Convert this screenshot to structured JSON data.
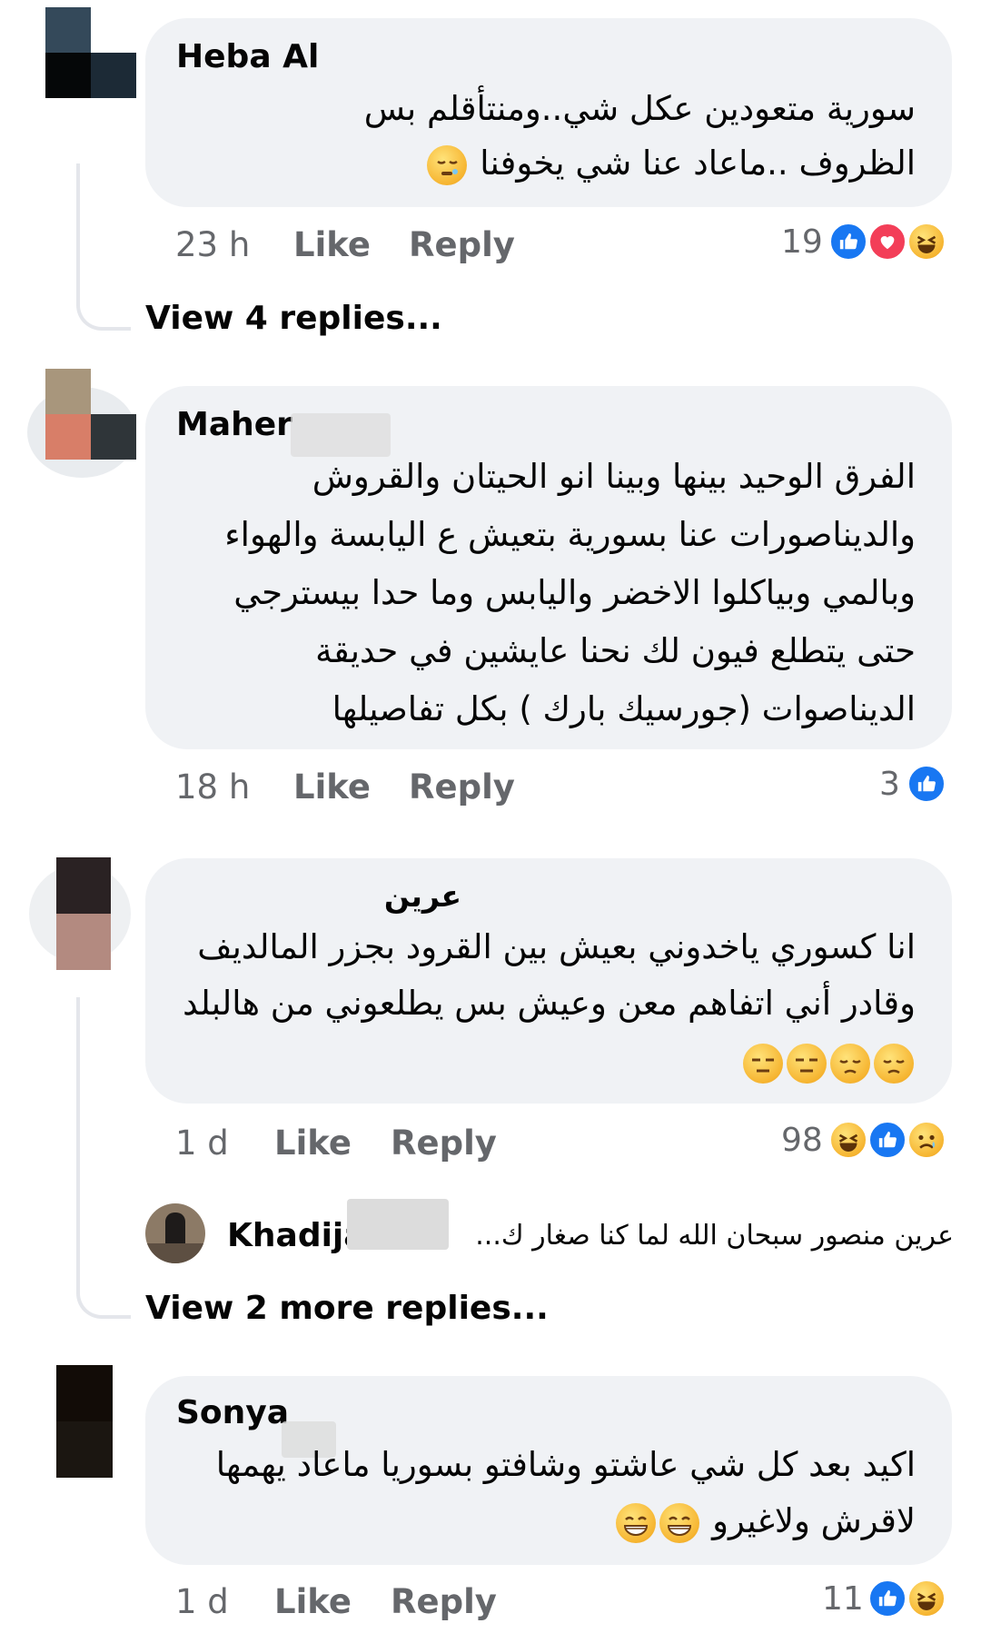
{
  "comments": [
    {
      "name": "Heba Al",
      "lines": [
        "سورية متعودين عكل شي..ومنتأقلم بس",
        "الظروف  ..ماعاد عنا شي يخوفنا"
      ],
      "time": "23 h",
      "like": "Like",
      "reply": "Reply",
      "reaction_count": "19",
      "reactions": [
        "like-icon",
        "love-icon",
        "haha-icon"
      ],
      "view_replies": "View 4 replies..."
    },
    {
      "name": "Maher",
      "lines": [
        "الفرق الوحيد بينها وبينا انو الحيتان والقروش",
        "والديناصورات عنا بسورية بتعيش ع اليابسة والهواء",
        "وبالمي  وبياكلوا الاخضر واليابس وما حدا بيسترجي",
        "حتى يتطلع فيون لك نحنا عايشين في حديقة",
        "الديناصوات (جورسيك بارك ) بكل تفاصيلها"
      ],
      "time": "18 h",
      "like": "Like",
      "reply": "Reply",
      "reaction_count": "3",
      "reactions": [
        "like-icon"
      ]
    },
    {
      "name": "عرين",
      "lines": [
        "انا كسوري ياخدوني بعيش بين القرود بجزر المالديف",
        "وقادر أني اتفاهم معن وعيش بس يطلعوني من هالبلد"
      ],
      "emojis": [
        "pensive-face-icon",
        "pensive-face-icon",
        "expressionless-face-icon",
        "expressionless-face-icon"
      ],
      "time": "1 d",
      "like": "Like",
      "reply": "Reply",
      "reaction_count": "98",
      "reactions": [
        "haha-icon",
        "like-icon",
        "sad-icon"
      ],
      "reply_preview": {
        "name": "Khadija",
        "text": "عرين منصور سبحان الله لما كنا صغار ك..."
      },
      "view_replies": "View 2 more replies..."
    },
    {
      "name": "Sonya",
      "lines": [
        "اكيد بعد كل شي عاشتو وشافتو بسوريا ماعاد يهمها",
        "لاقرش ولاغيرو"
      ],
      "emojis": [
        "grinning-face-icon",
        "grinning-face-icon"
      ],
      "time": "1 d",
      "like": "Like",
      "reply": "Reply",
      "reaction_count": "11",
      "reactions": [
        "like-icon",
        "haha-icon"
      ]
    }
  ],
  "colors": {
    "bubble": "#f0f2f5",
    "meta_text": "#65676b",
    "like_blue": "#1877f2",
    "love_red": "#f33e58",
    "haha_yellow": "#f6b531"
  }
}
